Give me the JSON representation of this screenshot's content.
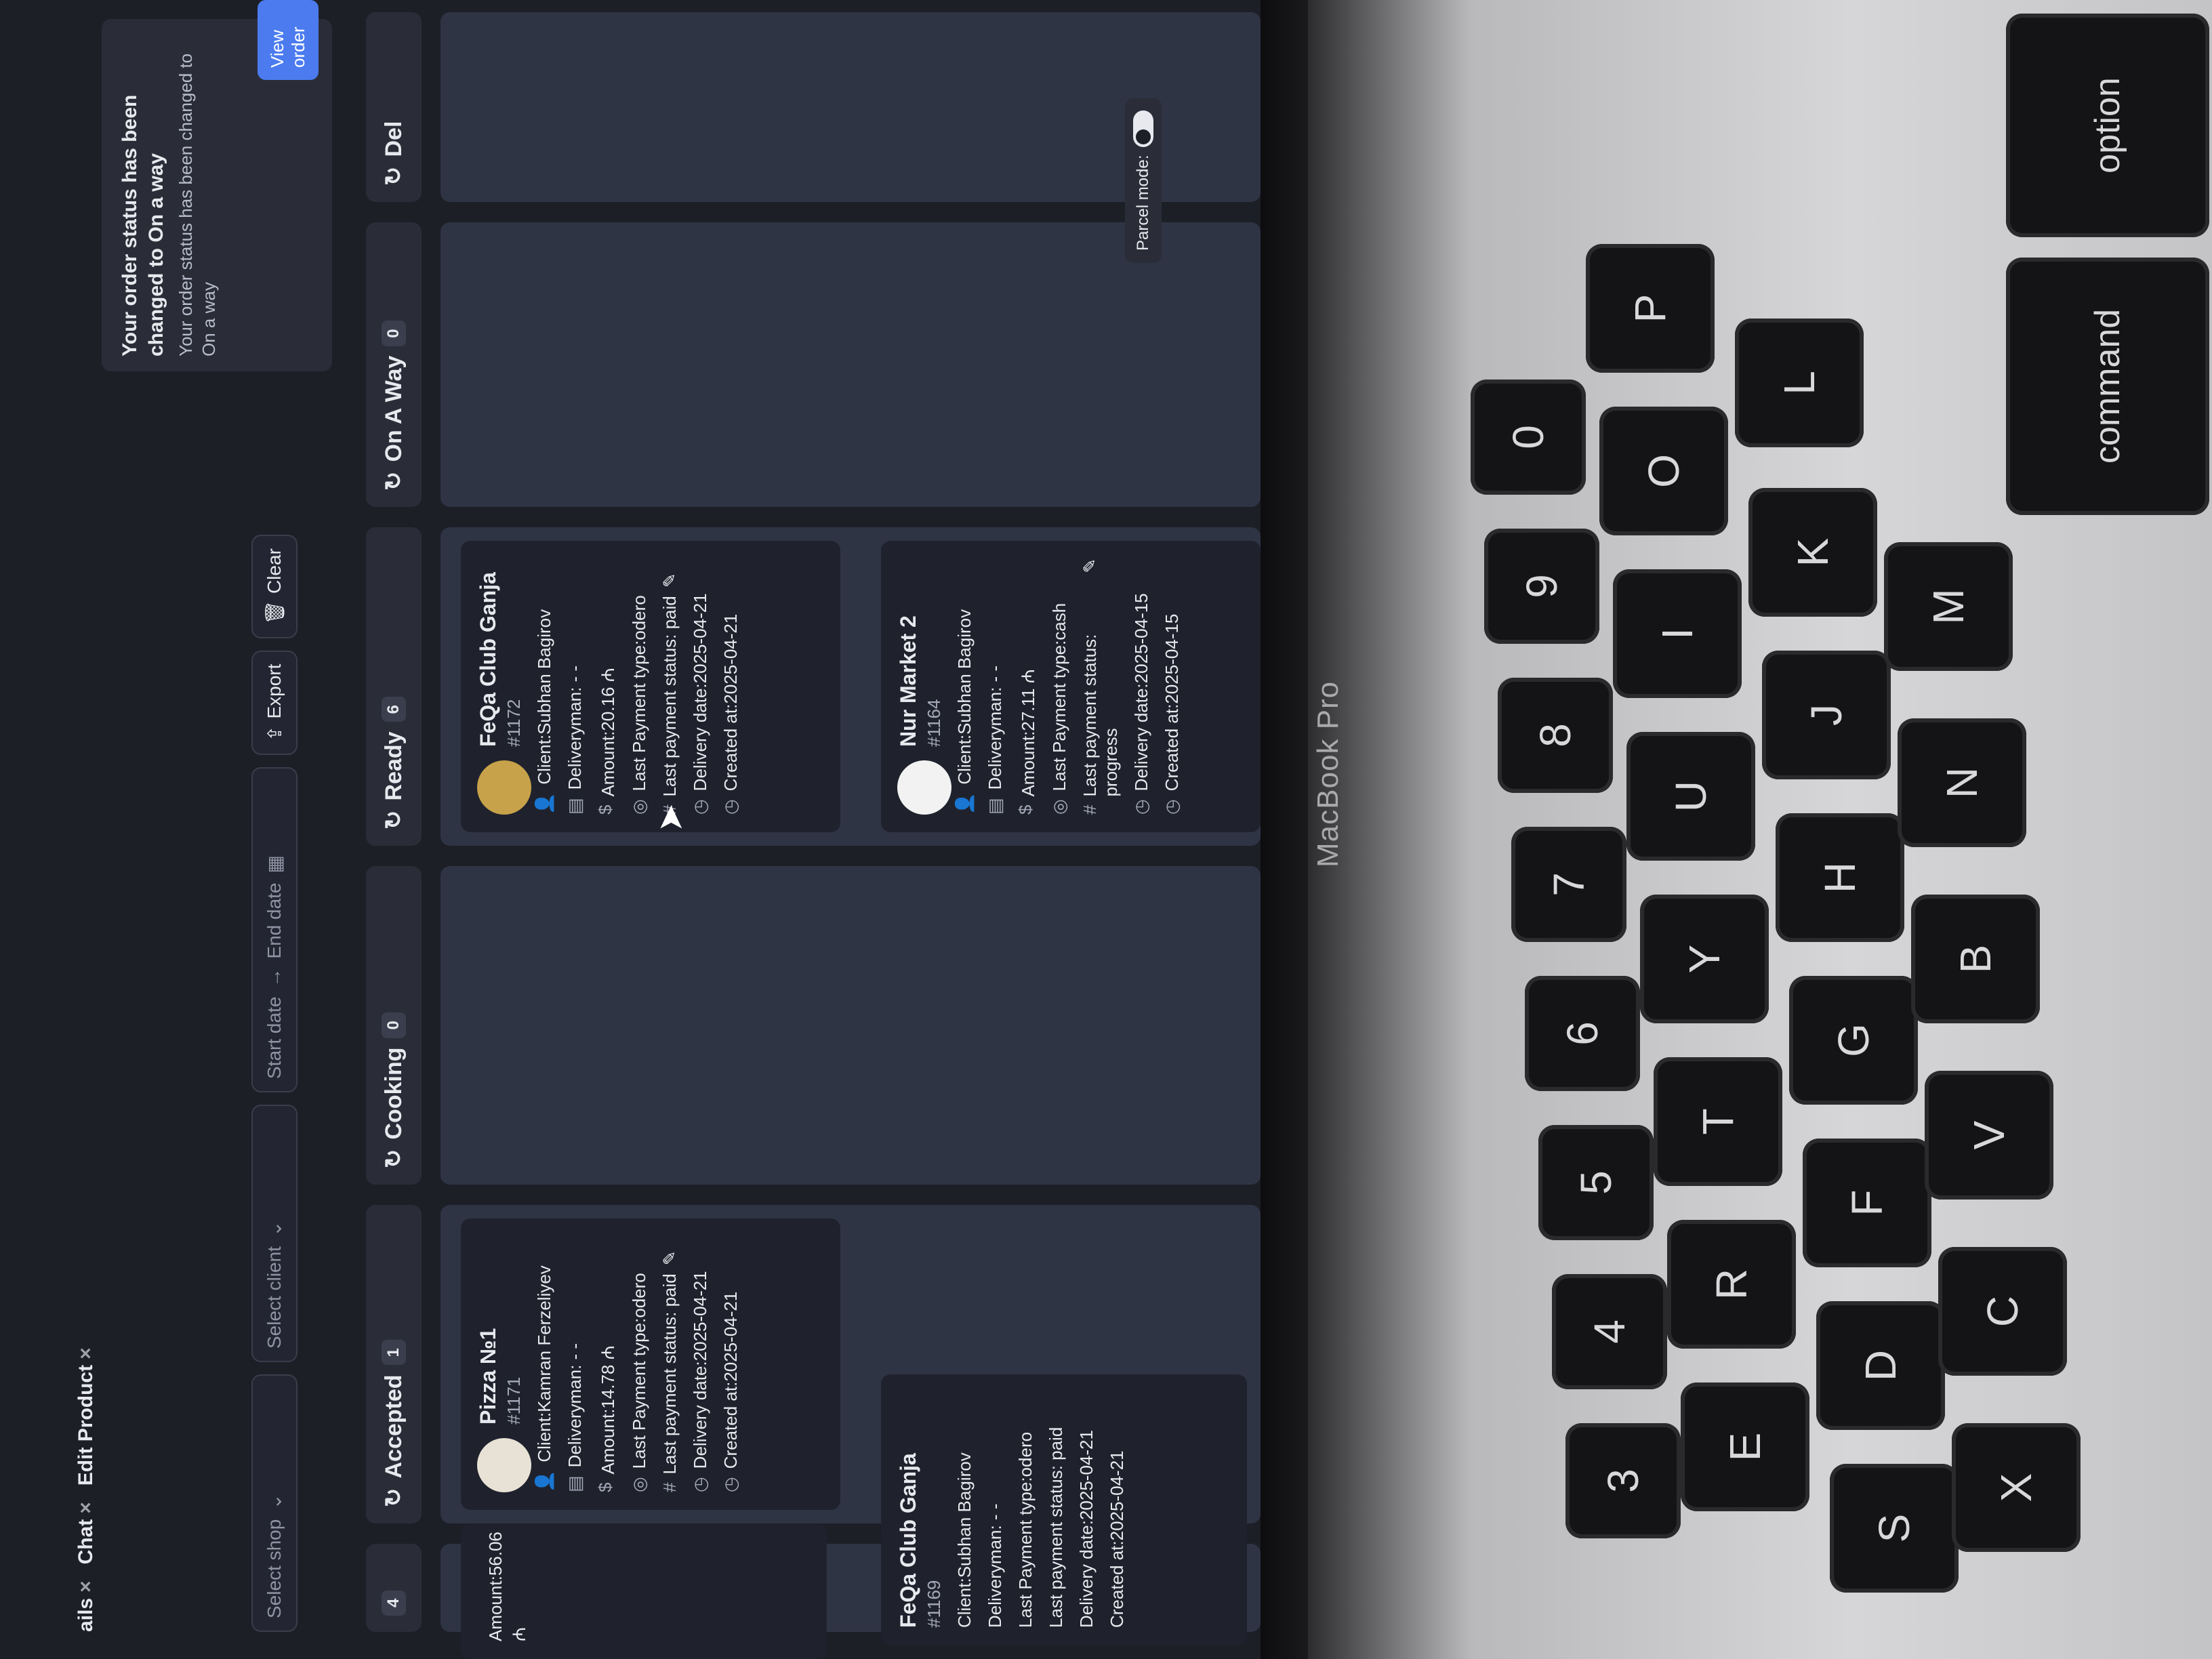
{
  "tabs": [
    {
      "label": "ails"
    },
    {
      "label": "Chat"
    },
    {
      "label": "Edit Product"
    }
  ],
  "toolbar": {
    "shop_placeholder": "Select shop",
    "client_placeholder": "Select client",
    "start_date": "Start date",
    "end_date": "End date",
    "export_label": "Export",
    "clear_label": "Clear"
  },
  "notification": {
    "title": "Your order status has been changed to On a way",
    "body": "Your order status has been changed to On a way",
    "button": "View order"
  },
  "columns": [
    {
      "label": "Accepted",
      "count": "1"
    },
    {
      "label": "Cooking",
      "count": "0"
    },
    {
      "label": "Ready",
      "count": "6"
    },
    {
      "label": "On A Way",
      "count": "0"
    },
    {
      "label": "Del"
    }
  ],
  "cards": {
    "accepted_1": {
      "name": "Pizza №1",
      "number": "#1171",
      "client": "Client:Kamran Ferzeliyev",
      "deliveryman": "Deliveryman: - -",
      "amount": "Amount:14.78 ₼",
      "payment_type": "Last Payment type:odero",
      "payment_status": "Last payment status: paid",
      "delivery_date": "Delivery date:2025-04-21",
      "created_at": "Created at:2025-04-21"
    },
    "ready_1": {
      "name": "FeQa Club Ganja",
      "number": "#1172",
      "client": "Client:Subhan Bagirov",
      "deliveryman": "Deliveryman: - -",
      "amount": "Amount:20.16 ₼",
      "payment_type": "Last Payment type:odero",
      "payment_status": "Last payment status: paid",
      "delivery_date": "Delivery date:2025-04-21",
      "created_at": "Created at:2025-04-21"
    },
    "ready_2": {
      "name": "Nur Market 2",
      "number": "#1164",
      "client": "Client:Subhan Bagirov",
      "deliveryman": "Deliveryman: - -",
      "amount": "Amount:27.11 ₼",
      "payment_type": "Last Payment type:cash",
      "payment_status": "Last payment status: progress",
      "delivery_date": "Delivery date:2025-04-15",
      "created_at": "Created at:2025-04-15"
    },
    "left_1": {
      "name": "FeQa Club Ganja",
      "number": "#1169",
      "client": "Client:Subhan Bagirov",
      "deliveryman": "Deliveryman: - -",
      "amount": "Amount:56.06 ₼",
      "payment_type": "Last Payment type:odero",
      "payment_status": "Last payment status: paid",
      "delivery_date": "Delivery date:2025-04-21",
      "created_at": "Created at:2025-04-21"
    }
  },
  "parcel_mode": "Parcel mode:",
  "laptop_brand": "MacBook Pro",
  "keys": {
    "option": "option",
    "command": "command",
    "p": "P",
    "o": "O",
    "i": "I",
    "u": "U",
    "y": "Y",
    "t": "T",
    "r": "R",
    "e": "E",
    "l": "L",
    "k": "K",
    "j": "J",
    "h": "H",
    "g": "G",
    "f": "F",
    "d": "D",
    "s": "S",
    "m": "M",
    "n": "N",
    "b": "B",
    "v": "V",
    "c": "C",
    "x": "X",
    "n0": "0",
    "n9": "9",
    "n8": "8",
    "n7": "7",
    "n6": "6",
    "n5": "5",
    "n4": "4",
    "n3": "3"
  }
}
